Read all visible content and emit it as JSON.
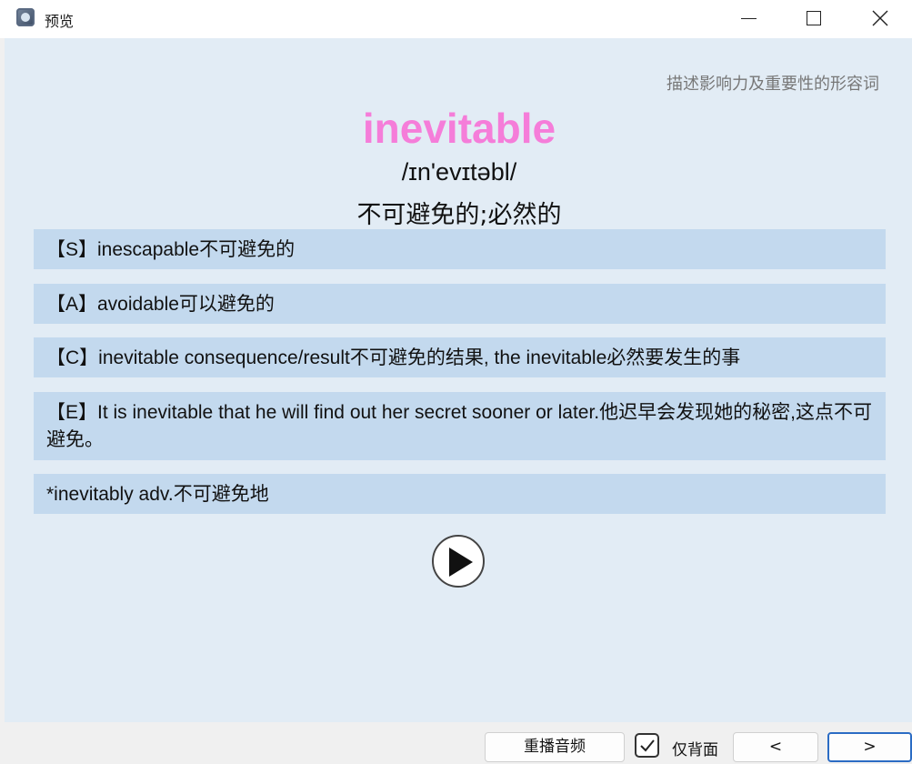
{
  "window": {
    "title": "预览",
    "icon": "app-icon",
    "controls": [
      "minimize-icon",
      "maximize-icon",
      "close-icon"
    ]
  },
  "card": {
    "category": "描述影响力及重要性的形容词",
    "word": "inevitable",
    "word_color": "#f57dd9",
    "phonetic": "/ɪn'evɪtəbl/",
    "meaning": "不可避免的;必然的",
    "rows": {
      "synonym": "【S】inescapable不可避免的",
      "antonym": "【A】avoidable可以避免的",
      "collocation": "【C】inevitable consequence/result不可避免的结果, the inevitable必然要发生的事",
      "example": "【E】It is inevitable that he will find out her secret sooner or later.他迟早会发现她的秘密,这点不可避免。",
      "derivative": "*inevitably adv.不可避免地"
    },
    "row_color": "#c3d9ee",
    "background_color": "#e2ecf5"
  },
  "play": {
    "icon": "play-icon"
  },
  "bottom": {
    "replay_label": "重播音频",
    "back_only_label": "仅背面",
    "back_only_checked": true,
    "prev_label": "<",
    "next_label": ">"
  }
}
